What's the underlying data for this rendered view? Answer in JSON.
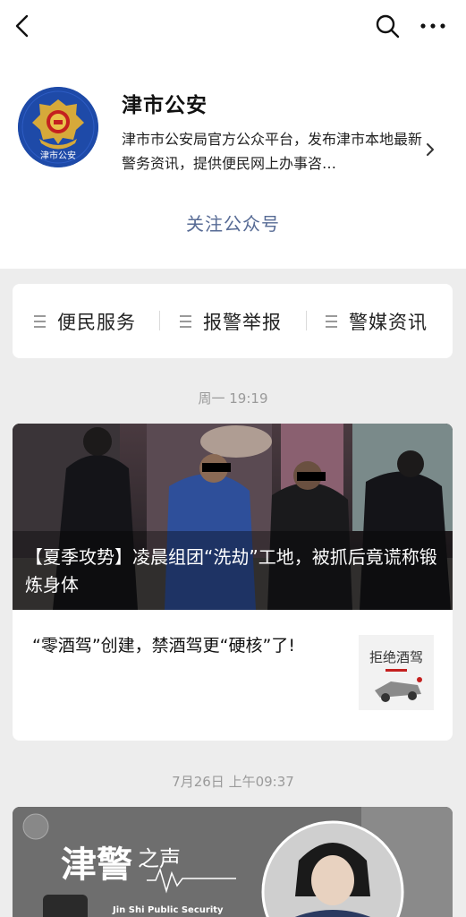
{
  "nav": {
    "back_icon": "back-arrow-icon",
    "search_icon": "search-icon",
    "more_icon": "more-icon"
  },
  "account": {
    "name": "津市公安",
    "description": "津市市公安局官方公众平台，发布津市本地最新警务资讯，提供便民网上办事咨…",
    "avatar_text": "津市公安",
    "follow_label": "关注公众号"
  },
  "menu": [
    {
      "label": "便民服务"
    },
    {
      "label": "报警举报"
    },
    {
      "label": "警媒资讯"
    }
  ],
  "feed": [
    {
      "time": "周一 19:19",
      "hero_title": "【夏季攻势】凌晨组团“洗劫”工地，被抓后竟谎称锻炼身体",
      "sub_title": "“零酒驾”创建，禁酒驾更“硬核”了!",
      "thumb_text": "拒绝酒驾"
    },
    {
      "time": "7月26日 上午09:37",
      "banner_title_1": "津警",
      "banner_title_2": "之声",
      "banner_subtitle": "Jin Shi Public Security"
    }
  ],
  "colors": {
    "link": "#576b95",
    "police_blue": "#1e4aa8",
    "gold": "#d6a93a"
  }
}
